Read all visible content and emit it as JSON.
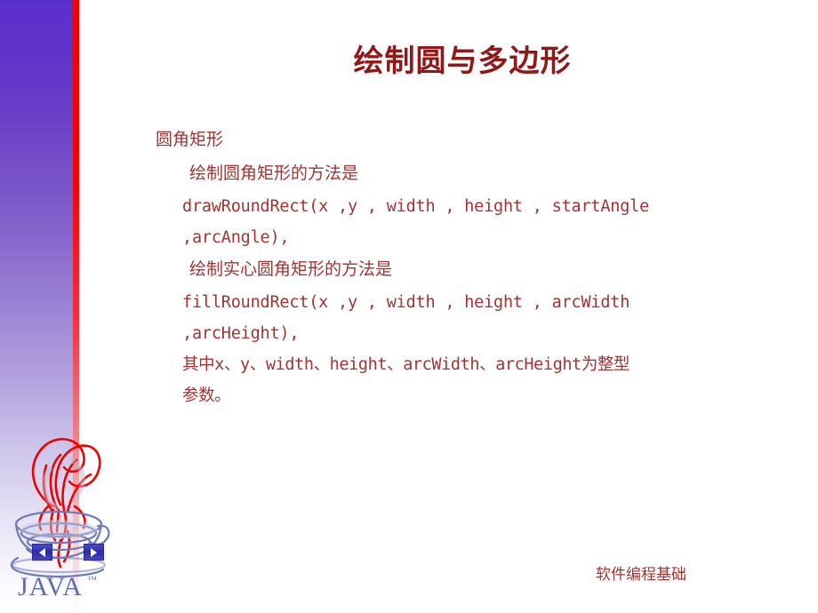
{
  "slide": {
    "title": "绘制圆与多边形",
    "title_color": "#8f1818",
    "body_color": "#a33434",
    "footer": "软件编程基础"
  },
  "sidebar": {
    "gradient_top_color": "#5b2fcc",
    "gradient_bottom_color": "#ffffff",
    "stripe_color": "#f50000"
  },
  "logo": {
    "wordmark": "JAVA",
    "trademark": "™",
    "steam_color": "#ee0000",
    "cup_color": "#6d7cb8"
  },
  "nav": {
    "prev_label": "◀",
    "next_label": "▶"
  },
  "content": {
    "lines": [
      {
        "text": "圆角矩形",
        "style": "lvl1"
      },
      {
        "text": "绘制圆角矩形的方法是",
        "style": "lvl2"
      },
      {
        "text": "drawRoundRect(x ,y , width , height , startAngle",
        "style": "code"
      },
      {
        "text": ",arcAngle),",
        "style": "code"
      },
      {
        "text": "绘制实心圆角矩形的方法是",
        "style": "lvl2"
      },
      {
        "text": "fillRoundRect(x ,y , width , height , arcWidth",
        "style": "code"
      },
      {
        "text": ",arcHeight),",
        "style": "code"
      },
      {
        "text": "其中x、y、width、height、arcWidth、arcHeight为整型",
        "style": "mixed"
      },
      {
        "text": "参数。",
        "style": "mixed"
      }
    ]
  }
}
